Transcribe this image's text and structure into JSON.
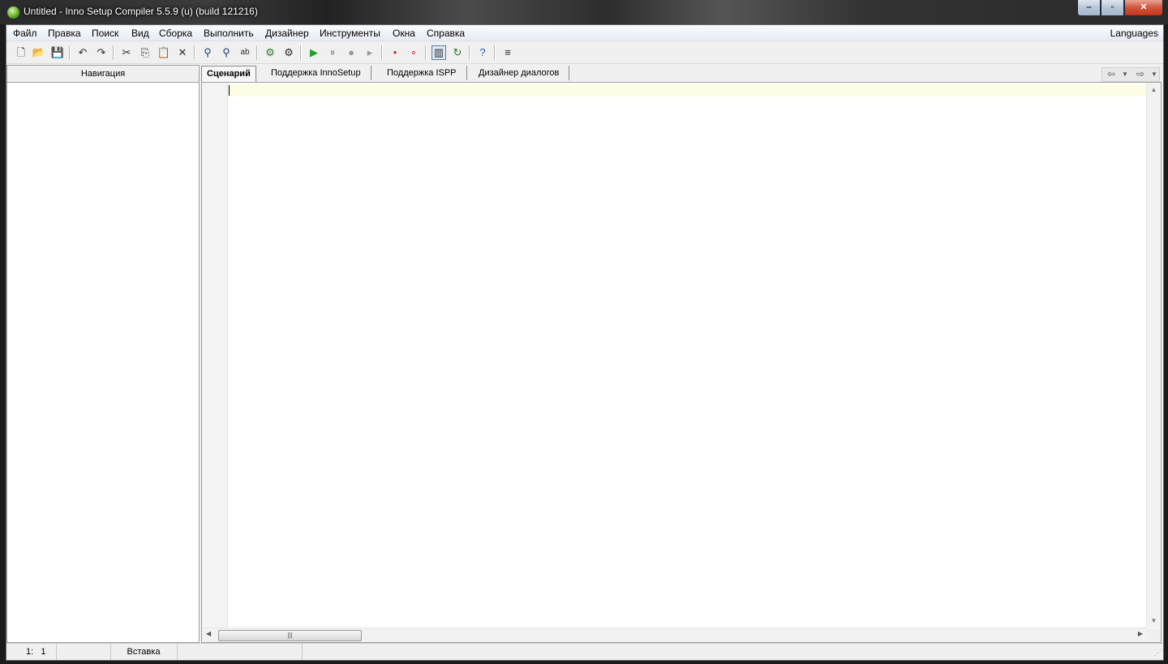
{
  "window": {
    "title": "Untitled - Inno Setup Compiler 5.5.9 (u) (build 121216)",
    "minimize": "‒",
    "maximize": "▫",
    "close": "✕"
  },
  "menu": {
    "items": [
      "Файл",
      "Правка",
      "Поиск",
      "Вид",
      "Сборка",
      "Выполнить",
      "Дизайнер",
      "Инструменты",
      "Окна",
      "Справка"
    ],
    "languages": "Languages"
  },
  "toolbar": {
    "icons": [
      "new-file-icon",
      "open-folder-icon",
      "save-icon",
      "undo-icon",
      "redo-icon",
      "cut-icon",
      "copy-icon",
      "paste-icon",
      "delete-icon",
      "find-icon",
      "find-next-icon",
      "replace-icon",
      "compile-icon",
      "compile-setup-icon",
      "run-icon",
      "pause-icon",
      "stop-icon",
      "step-icon",
      "toggle-breakpoint-icon",
      "clear-breakpoint-icon",
      "navigation-panel-icon",
      "refresh-icon",
      "help-icon",
      "word-wrap-icon"
    ]
  },
  "navigation": {
    "header": "Навигация"
  },
  "tabs": [
    {
      "label": "Сценарий",
      "active": true
    },
    {
      "label": "Поддержка InnoSetup",
      "active": false
    },
    {
      "label": "Поддержка ISPP",
      "active": false
    },
    {
      "label": "Дизайнер диалогов",
      "active": false
    }
  ],
  "editor": {
    "content": "",
    "hscroll_thumb": "|||"
  },
  "statusbar": {
    "position": "1:   1",
    "mode": "Вставка"
  },
  "colors": {
    "current_line": "#fdfde6",
    "menubar": "#eef2f8",
    "window_bg": "#f0f0f0"
  }
}
